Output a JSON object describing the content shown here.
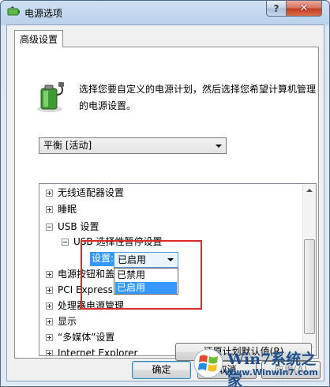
{
  "window": {
    "title": "电源选项",
    "help_label": "?",
    "close_label": "✕"
  },
  "tab": {
    "label": "高级设置"
  },
  "intro": {
    "line1": "选择您要自定义的电源计划，然后选择您希望计算机管理",
    "line2": "的电源设置。"
  },
  "plan": {
    "selected": "平衡 [活动]"
  },
  "tree": {
    "items": [
      {
        "label": "无线适配器设置",
        "state": "plus"
      },
      {
        "label": "睡眠",
        "state": "plus"
      },
      {
        "label": "USB 设置",
        "state": "minus"
      },
      {
        "label": "USB 选择性暂停设置",
        "state": "minus"
      },
      {
        "label": "电源按钮和盖",
        "state": "plus"
      },
      {
        "label": "PCI Express",
        "state": "plus"
      },
      {
        "label": "处理器电源管理",
        "state": "plus"
      },
      {
        "label": "显示",
        "state": "plus"
      },
      {
        "label": "“多媒体”设置",
        "state": "plus"
      },
      {
        "label": "Internet Explorer",
        "state": "plus"
      }
    ],
    "setting": {
      "label": "设置:",
      "value": "已启用",
      "options": [
        "已禁用",
        "已启用"
      ],
      "selected_option": "已启用"
    }
  },
  "buttons": {
    "restore": "还原计划默认值(R)",
    "ok": "确定",
    "cancel": "取消",
    "apply": "应用(A)"
  },
  "watermark": {
    "title": "Win7系统之家",
    "url": "Www.Winwin7.com"
  },
  "colors": {
    "highlight": "#3399ff",
    "annotation_box": "#e0282a"
  }
}
